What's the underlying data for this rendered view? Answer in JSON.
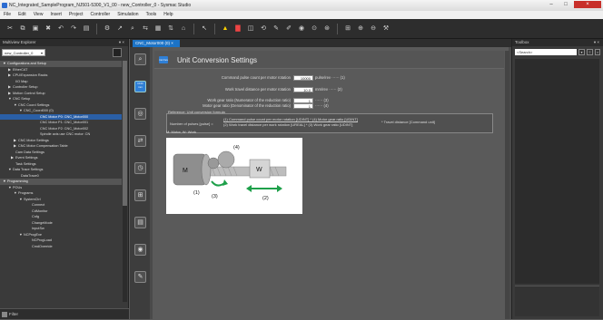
{
  "window": {
    "title": "NC_Integrated_SampleProgram_NJ501-5300_V1_00 - new_Controller_0 - Sysmac Studio",
    "minimize": "–",
    "maximize": "□",
    "close": "×"
  },
  "menu": [
    "File",
    "Edit",
    "View",
    "Insert",
    "Project",
    "Controller",
    "Simulation",
    "Tools",
    "Help"
  ],
  "multiview": {
    "title": "Multiview Explorer",
    "pin": "▾ ×",
    "controller": "new_Controller_0",
    "filter_label": "Filter",
    "tree": [
      {
        "label": "Configurations and Setup",
        "indent": 1,
        "hdr": true,
        "toggle": "▼"
      },
      {
        "label": "EtherCAT",
        "indent": 3,
        "toggle": "▶"
      },
      {
        "label": "CPU/Expansion Racks",
        "indent": 3,
        "toggle": "▶"
      },
      {
        "label": "I/O Map",
        "indent": 4,
        "toggle": ""
      },
      {
        "label": "Controller Setup",
        "indent": 3,
        "toggle": "▶"
      },
      {
        "label": "Motion Control Setup",
        "indent": 3,
        "toggle": "▶"
      },
      {
        "label": "CNC Setup",
        "indent": 3,
        "toggle": "▼"
      },
      {
        "label": "CNC Coord Settings",
        "indent": 5,
        "toggle": "▼"
      },
      {
        "label": "CNC_Coord000 (0)",
        "indent": 7,
        "toggle": "▼"
      },
      {
        "label": "CNC Motor P0: CNC_Motor000",
        "indent": 13,
        "sel": true,
        "toggle": ""
      },
      {
        "label": "CNC Motor P1: CNC_Motor001",
        "indent": 13,
        "toggle": ""
      },
      {
        "label": "CNC Motor P2: CNC_Motor002",
        "indent": 13,
        "toggle": ""
      },
      {
        "label": "Spindle axis use CNC motor: CN",
        "indent": 13,
        "toggle": ""
      },
      {
        "label": "CNC Motor Settings",
        "indent": 5,
        "toggle": "▶"
      },
      {
        "label": "CNC Motor Compensation Table",
        "indent": 5,
        "toggle": "▶"
      },
      {
        "label": "Cam Data Settings",
        "indent": 4,
        "toggle": ""
      },
      {
        "label": "Event Settings",
        "indent": 4,
        "toggle": "▶"
      },
      {
        "label": "Task Settings",
        "indent": 4,
        "toggle": ""
      },
      {
        "label": "Data Trace Settings",
        "indent": 3,
        "toggle": "▼"
      },
      {
        "label": "DataTrace0",
        "indent": 6,
        "toggle": ""
      },
      {
        "label": "Programming",
        "indent": 1,
        "hdr": true,
        "toggle": "▼"
      },
      {
        "label": "POUs",
        "indent": 3,
        "toggle": "▼"
      },
      {
        "label": "Programs",
        "indent": 5,
        "toggle": "▼"
      },
      {
        "label": "SystemCtrl",
        "indent": 7,
        "toggle": "▼"
      },
      {
        "label": "Connect",
        "indent": 10,
        "toggle": ""
      },
      {
        "label": "CdMonitor",
        "indent": 10,
        "toggle": ""
      },
      {
        "label": "Cnfg",
        "indent": 10,
        "toggle": ""
      },
      {
        "label": "ChangeMode",
        "indent": 10,
        "toggle": ""
      },
      {
        "label": "InputSw",
        "indent": 10,
        "toggle": ""
      },
      {
        "label": "NCProgExe",
        "indent": 7,
        "toggle": "▼"
      },
      {
        "label": "NCProgLoad",
        "indent": 10,
        "toggle": ""
      },
      {
        "label": "CmdOverride",
        "indent": 10,
        "toggle": ""
      }
    ]
  },
  "editor": {
    "tab_label": "CNC_Motor000 (0) ×",
    "title": "Unit Conversion Settings",
    "header_icon_text": "mm/rev",
    "icon_active_text": "CNC mm",
    "fields": {
      "cmd_pulse_label": "Command pulse count per motor rotation",
      "cmd_pulse_value": "10000",
      "cmd_pulse_unit": "pulse/rev ······ (1)",
      "work_travel_label": "Work travel distance per motor rotation",
      "work_travel_value": "10.0",
      "work_travel_unit": "mm/rev ······ (2)",
      "gear_num_label": "Work gear ratio (Numerator of the reduction ratio)",
      "gear_num_value": "1",
      "gear_num_unit": "······ (3)",
      "gear_den_label": "Motor gear ratio (Denominator of the reduction ratio)",
      "gear_den_value": "1",
      "gear_den_unit": "······ (4)"
    },
    "formula": {
      "title": "Reference: Unit conversion formula",
      "lhs": "Number of pulses [pulse] =",
      "numerator": "(1) Command pulse count per motor rotation [UDINT] * (4) Motor gear ratio [UDINT]",
      "denominator": "(2) Work travel distance per work rotation [UREAL] * (3) Work gear ratio [UDINT]",
      "rhs": "* Travel distance [Command unit]"
    },
    "diagram_caption": "M: Motor, W: Work",
    "diagram_labels": {
      "m": "M",
      "w": "W",
      "l1": "(1)",
      "l2": "(2)",
      "l3": "(3)",
      "l4": "(4)"
    }
  },
  "toolbox": {
    "title": "Toolbox",
    "pin": "▾ ×",
    "search": "<Search>"
  }
}
